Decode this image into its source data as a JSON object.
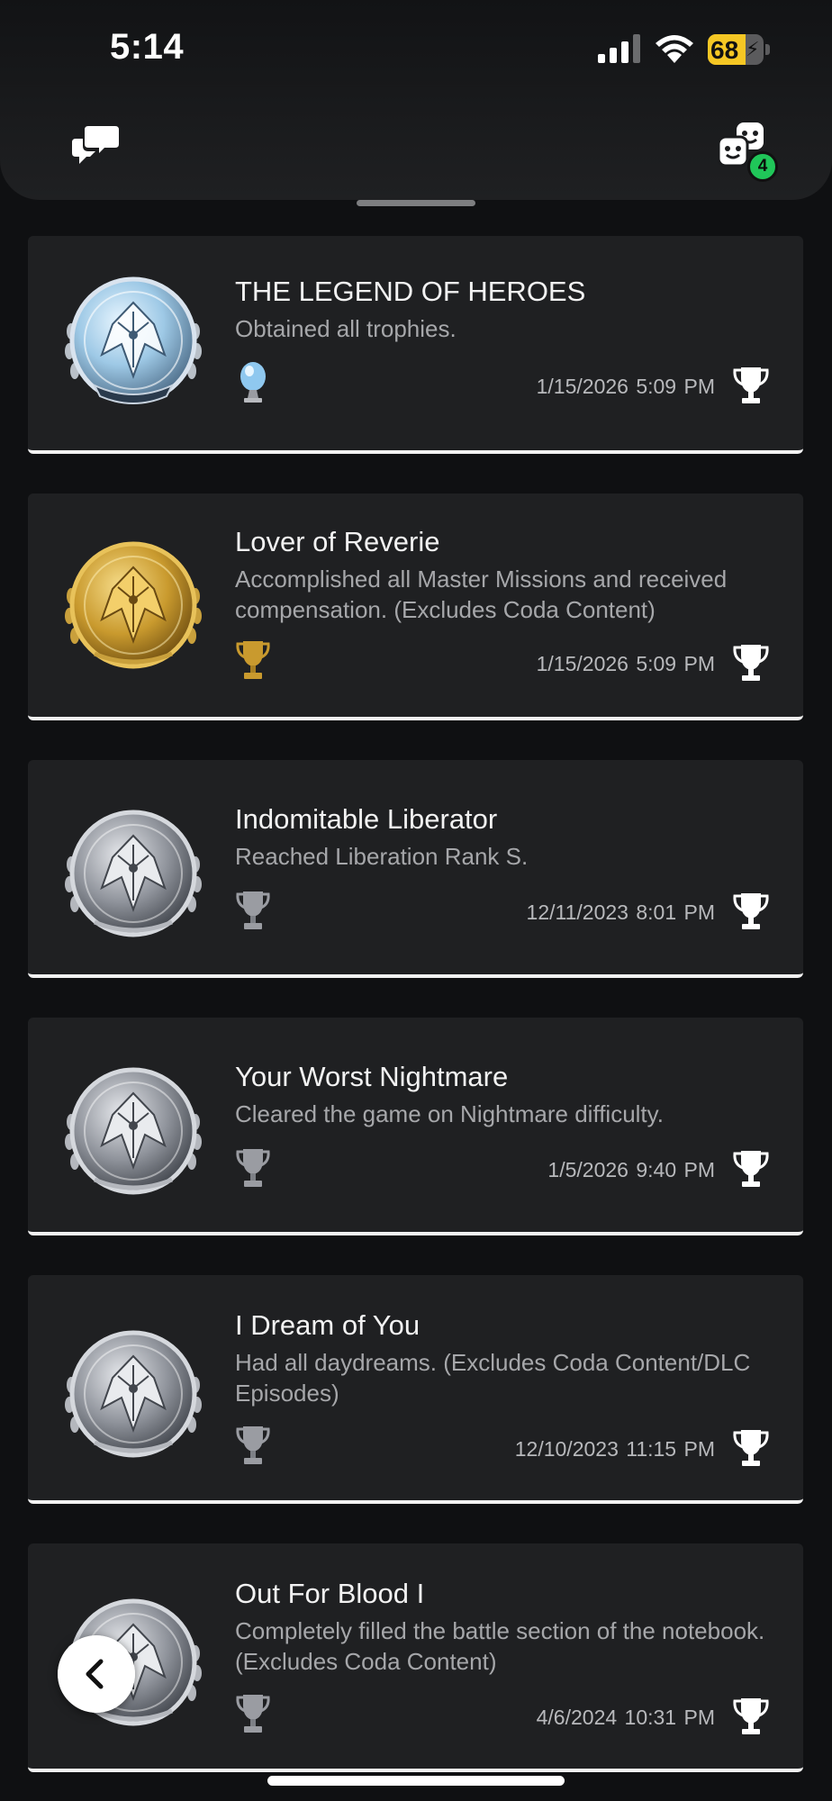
{
  "status_bar": {
    "time": "5:14",
    "battery_percent": "68",
    "battery_level": 0.68,
    "battery_color": "#f5c724"
  },
  "header": {
    "chat_icon": "chat-bubbles-icon",
    "friends_icon": "friends-icon",
    "friends_badge": "4",
    "badge_color": "#20c659"
  },
  "trophies": [
    {
      "title": "THE LEGEND OF HEROES",
      "description": "Obtained all trophies.",
      "grade": "platinum",
      "date": "1/15/2026  5:09 PM"
    },
    {
      "title": "Lover of Reverie",
      "description": "Accomplished all Master Missions and received compensation. (Excludes Coda Content)",
      "grade": "gold",
      "date": "1/15/2026  5:09 PM"
    },
    {
      "title": "Indomitable Liberator",
      "description": "Reached Liberation Rank S.",
      "grade": "silver",
      "date": "12/11/2023  8:01 PM"
    },
    {
      "title": "Your Worst Nightmare",
      "description": "Cleared the game on Nightmare difficulty.",
      "grade": "silver",
      "date": "1/5/2026  9:40 PM"
    },
    {
      "title": "I Dream of You",
      "description": "Had all daydreams. (Excludes Coda Content/DLC Episodes)",
      "grade": "silver",
      "date": "12/10/2023  11:15 PM"
    },
    {
      "title": "Out For Blood I",
      "description": "Completely filled the battle section of the notebook. (Excludes Coda Content)",
      "grade": "silver",
      "date": "4/6/2024  10:31 PM"
    }
  ],
  "grade_colors": {
    "platinum": "#8fc8ef",
    "gold": "#c99a2e",
    "silver": "#9a9ca2"
  }
}
